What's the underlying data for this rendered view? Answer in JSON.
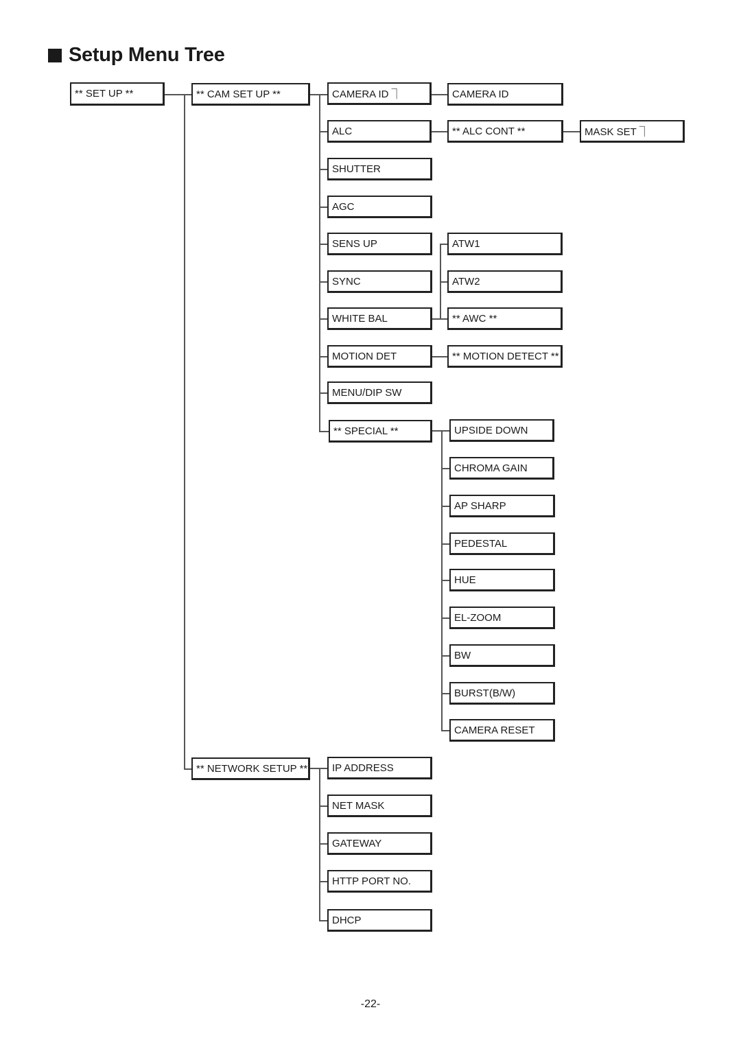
{
  "page_title": "Setup Menu Tree",
  "page_number": "-22-",
  "icons": {
    "title_bullet": "black-square-icon",
    "submenu_marker": "return-arrow-icon"
  },
  "tree": {
    "root": "** SET UP **",
    "cam_setup": {
      "label": "** CAM  SET UP **",
      "items": {
        "camera_id": "CAMERA ID ⏋",
        "alc": "ALC",
        "shutter": "SHUTTER",
        "agc": "AGC",
        "sens_up": "SENS UP",
        "sync": "SYNC",
        "white_bal": "WHITE BAL",
        "motion_det": "MOTION DET",
        "menu_dip_sw": "MENU/DIP SW",
        "special": "** SPECIAL **"
      },
      "camera_id_child": "CAMERA ID",
      "alc_child": "** ALC CONT **",
      "alc_cont_child": "MASK SET ⏋",
      "white_bal_children": [
        "ATW1",
        "ATW2",
        "** AWC **"
      ],
      "motion_det_child": "** MOTION DETECT **",
      "special_children": [
        "UPSIDE DOWN",
        "CHROMA GAIN",
        "AP SHARP",
        "PEDESTAL",
        "HUE",
        "EL-ZOOM",
        "BW",
        "BURST(B/W)",
        "CAMERA RESET"
      ]
    },
    "network_setup": {
      "label": "** NETWORK SETUP **",
      "items": [
        "IP ADDRESS",
        "NET MASK",
        "GATEWAY",
        "HTTP PORT NO.",
        "DHCP"
      ]
    }
  }
}
